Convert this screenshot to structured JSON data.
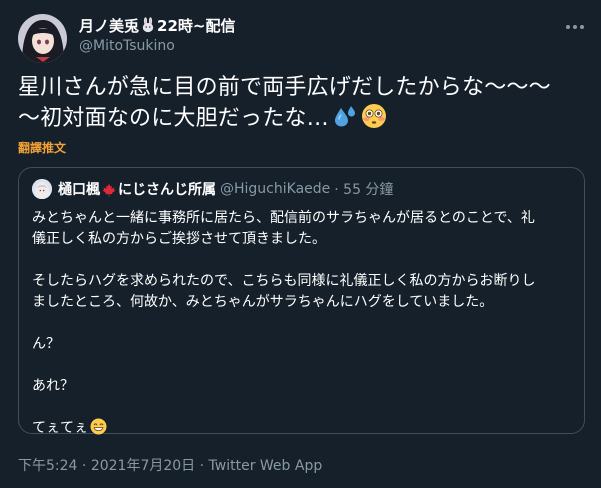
{
  "author": {
    "name_prefix": "月ノ美兎",
    "name_suffix": "22時~配信",
    "handle": "@MitoTsukino"
  },
  "tweet": {
    "text_line1": "星川さんが急に目の前で両手広げだしたからな〜〜〜",
    "text_line2": "〜初対面なのに大胆だったな…",
    "translate_label": "翻譯推文"
  },
  "quote": {
    "name_prefix": "樋口楓",
    "name_suffix": "にじさんじ所属",
    "handle": "@HiguchiKaede",
    "time": "· 55 分鐘",
    "lines": [
      "みとちゃんと一緒に事務所に居たら、配信前のサラちゃんが居るとのことで、礼",
      "儀正しく私の方からご挨拶させて頂きました。",
      "",
      "そしたらハグを求められたので、こちらも同様に礼儀正しく私の方からお断りし",
      "ましたところ、何故か、みとちゃんがサラちゃんにハグをしていました。",
      "",
      "ん？",
      "",
      "あれ？",
      "",
      "てぇてぇ"
    ]
  },
  "meta": {
    "time": "下午5:24",
    "sep1": " · ",
    "date": "2021年7月20日",
    "sep2": " · ",
    "source": "Twitter Web App"
  },
  "icons": {
    "rabbit": "rabbit-emoji",
    "maple": "maple-leaf-emoji",
    "droplets": "sweat-droplets-emoji",
    "flushed": "flushed-face-emoji",
    "grin": "grinning-face-emoji",
    "more": "more-dots-icon"
  },
  "colors": {
    "background": "#15202b",
    "secondary_text": "#8899a6",
    "translate": "#f4a236",
    "border": "#3d4f5f"
  }
}
